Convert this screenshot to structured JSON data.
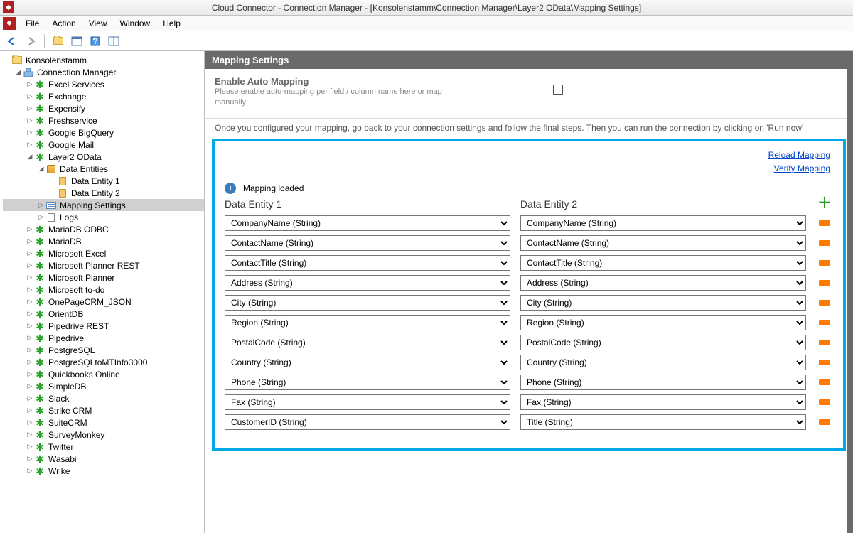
{
  "window": {
    "title": "Cloud Connector - Connection Manager - [Konsolenstamm\\Connection Manager\\Layer2 OData\\Mapping Settings]"
  },
  "menu": [
    "File",
    "Action",
    "View",
    "Window",
    "Help"
  ],
  "tree": {
    "root": "Konsolenstamm",
    "manager": "Connection Manager",
    "connections_before": [
      "Excel Services",
      "Exchange",
      "Expensify",
      "Freshservice",
      "Google BigQuery",
      "Google Mail"
    ],
    "odata": "Layer2 OData",
    "odata_children": {
      "entities": "Data Entities",
      "entity_items": [
        "Data Entity 1",
        "Data Entity 2"
      ],
      "mapping": "Mapping Settings",
      "logs": "Logs"
    },
    "connections_after": [
      "MariaDB ODBC",
      "MariaDB",
      "Microsoft Excel",
      "Microsoft Planner REST",
      "Microsoft Planner",
      "Microsoft to-do",
      "OnePageCRM_JSON",
      "OrientDB",
      "Pipedrive REST",
      "Pipedrive",
      "PostgreSQL",
      "PostgreSQLtoMTInfo3000",
      "Quickbooks Online",
      "SimpleDB",
      "Slack",
      "Strike CRM",
      "SuiteCRM",
      "SurveyMonkey",
      "Twitter",
      "Wasabi",
      "Wrike"
    ]
  },
  "panel": {
    "header": "Mapping Settings",
    "auto_title": "Enable Auto Mapping",
    "auto_desc": "Please enable auto-mapping per field / column name here or map manually.",
    "instruction": "Once you configured your mapping, go back to your connection settings and follow the final steps. Then you can run the connection by clicking on 'Run now'",
    "links": {
      "reload": "Reload Mapping",
      "verify": "Verify Mapping"
    },
    "status": "Mapping loaded",
    "left_header": "Data Entity 1",
    "right_header": "Data Entity 2",
    "rows": [
      {
        "l": "CompanyName (String)",
        "r": "CompanyName (String)"
      },
      {
        "l": "ContactName (String)",
        "r": "ContactName (String)"
      },
      {
        "l": "ContactTitle (String)",
        "r": "ContactTitle (String)"
      },
      {
        "l": "Address (String)",
        "r": "Address (String)"
      },
      {
        "l": "City (String)",
        "r": "City (String)"
      },
      {
        "l": "Region (String)",
        "r": "Region (String)"
      },
      {
        "l": "PostalCode (String)",
        "r": "PostalCode (String)"
      },
      {
        "l": "Country (String)",
        "r": "Country (String)"
      },
      {
        "l": "Phone (String)",
        "r": "Phone (String)"
      },
      {
        "l": "Fax (String)",
        "r": "Fax (String)"
      },
      {
        "l": "CustomerID (String)",
        "r": "Title (String)"
      }
    ]
  }
}
